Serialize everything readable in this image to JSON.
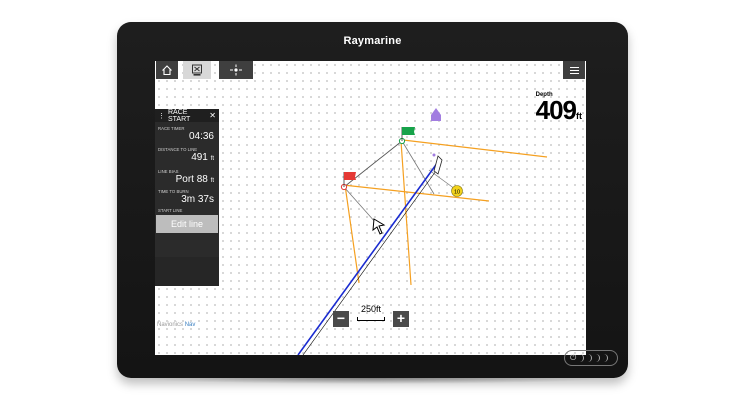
{
  "device": {
    "brand": "Raymarine"
  },
  "race_panel": {
    "title": "RACE START",
    "fields": [
      {
        "label": "RACE TIMER",
        "value": "04:36",
        "unit": ""
      },
      {
        "label": "DISTANCE TO LINE",
        "value": "491",
        "unit": "ft"
      },
      {
        "label": "LINE BIAS",
        "value": "Port 88",
        "unit": "ft"
      },
      {
        "label": "TIME TO BURN",
        "value": "3m 37s",
        "unit": ""
      }
    ],
    "start_line_label": "START LINE",
    "edit_button": "Edit line"
  },
  "depth": {
    "label": "Depth",
    "value": "409",
    "unit": "ft"
  },
  "map": {
    "scale_label": "250ft",
    "waypoint_label": "10",
    "logo_text": "Navionics",
    "logo_accent": "Nav"
  },
  "zoom": {
    "minus": "−",
    "plus": "+"
  },
  "colors": {
    "laylines": "#f5a020",
    "course_line": "#1a2bd0",
    "pin_flag": "#e53935",
    "boat_flag": "#17a34a",
    "waypoint": "#f2d21c",
    "target": "#a27de0"
  }
}
